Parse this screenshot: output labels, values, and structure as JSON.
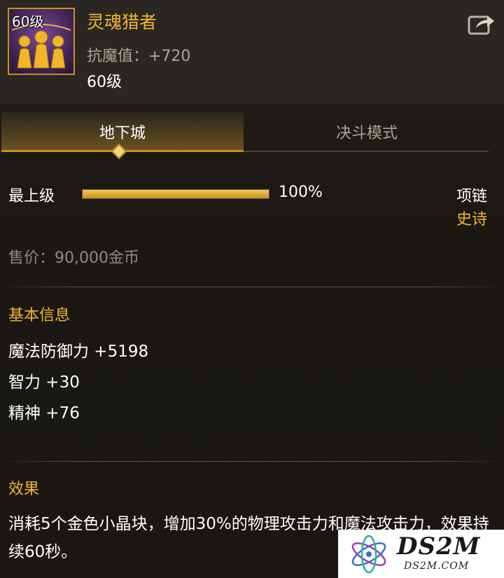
{
  "item": {
    "icon_level": "60级",
    "name": "灵魂猎者",
    "stat": "抗魔值：+720",
    "level": "60级",
    "icon": "soul-hunter-figures-icon"
  },
  "tabs": [
    {
      "label": "地下城",
      "active": true
    },
    {
      "label": "决斗模式",
      "active": false
    }
  ],
  "grade": {
    "label": "最上级",
    "percent_text": "100%",
    "progress": 1.0
  },
  "equipment": {
    "slot": "项链",
    "rarity": "史诗"
  },
  "price": "售价：90,000金币",
  "basic_info": {
    "title": "基本信息",
    "attributes": [
      "魔法防御力 +5198",
      "智力 +30",
      "精神 +76"
    ]
  },
  "effect": {
    "title": "效果",
    "text": "消耗5个金色小晶块，增加30%的物理攻击力和魔法攻击力，效果持续60秒。"
  },
  "watermark": {
    "main": "DS2M",
    "sub": "DS2M.COM"
  },
  "colors": {
    "accent": "#f2b52b",
    "background": "#1a1713",
    "muted": "#a9a49a"
  }
}
